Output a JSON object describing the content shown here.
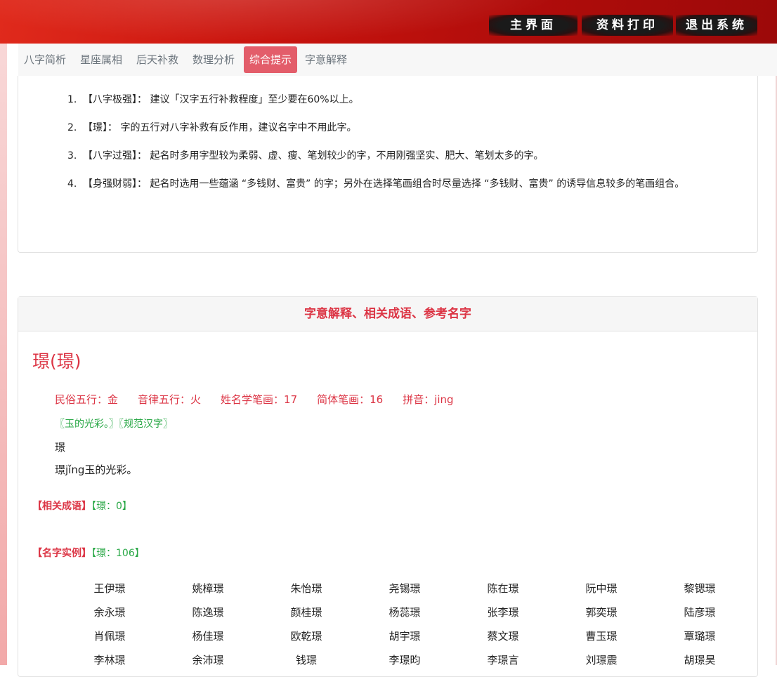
{
  "header": {
    "buttons": [
      "主界面",
      "资料打印",
      "退出系统"
    ]
  },
  "nav": {
    "tabs": [
      "八字简析",
      "星座属相",
      "后天补救",
      "数理分析",
      "综合提示",
      "字意解释"
    ],
    "active": "综合提示"
  },
  "tips": [
    {
      "num": "1.",
      "text": "【八字极强】：  建议「汉字五行补救程度」至少要在60%以上。"
    },
    {
      "num": "2.",
      "text": "【璟】：  字的五行对八字补救有反作用，建议名字中不用此字。"
    },
    {
      "num": "3.",
      "text": "【八字过强】：  起名时多用字型较为柔弱、虚、瘦、笔划较少的字，不用刚强坚实、肥大、笔划太多的字。"
    },
    {
      "num": "4.",
      "text": "【身强财弱】：  起名时选用一些蕴涵 “多钱财、富贵” 的字；另外在选择笔画组合时尽量选择 “多钱财、富贵” 的诱导信息较多的笔画组合。"
    }
  ],
  "section": {
    "title": "字意解释、相关成语、参考名字",
    "char": "璟(璟)",
    "attrs": [
      "民俗五行：金",
      "音律五行：火",
      "姓名学笔画：17",
      "简体笔画：16",
      "拼音：jing"
    ],
    "tags": "〖玉的光彩。〗〖规范汉字〗",
    "line1": "璟",
    "line2": "璟jǐng玉的光彩。",
    "idiom_label": "【相关成语】",
    "idiom_count": "【璟：0】",
    "names_label": "【名字实例】",
    "names_count": "【璟：106】"
  },
  "names": [
    [
      "王伊璟",
      "姚樟璟",
      "朱怡璟",
      "尧锡璟",
      "陈在璟",
      "阮中璟",
      "黎锶璟"
    ],
    [
      "余永璟",
      "陈逸璟",
      "颜桂璟",
      "杨蕊璟",
      "张李璟",
      "郭奕璟",
      "陆彦璟"
    ],
    [
      "肖佩璟",
      "杨佳璟",
      "欧乾璟",
      "胡宇璟",
      "蔡文璟",
      "曹玉璟",
      "覃璐璟"
    ],
    [
      "李林璟",
      "余沛璟",
      "钱璟",
      "李璟昀",
      "李璟言",
      "刘璟震",
      "胡璟昊"
    ]
  ]
}
